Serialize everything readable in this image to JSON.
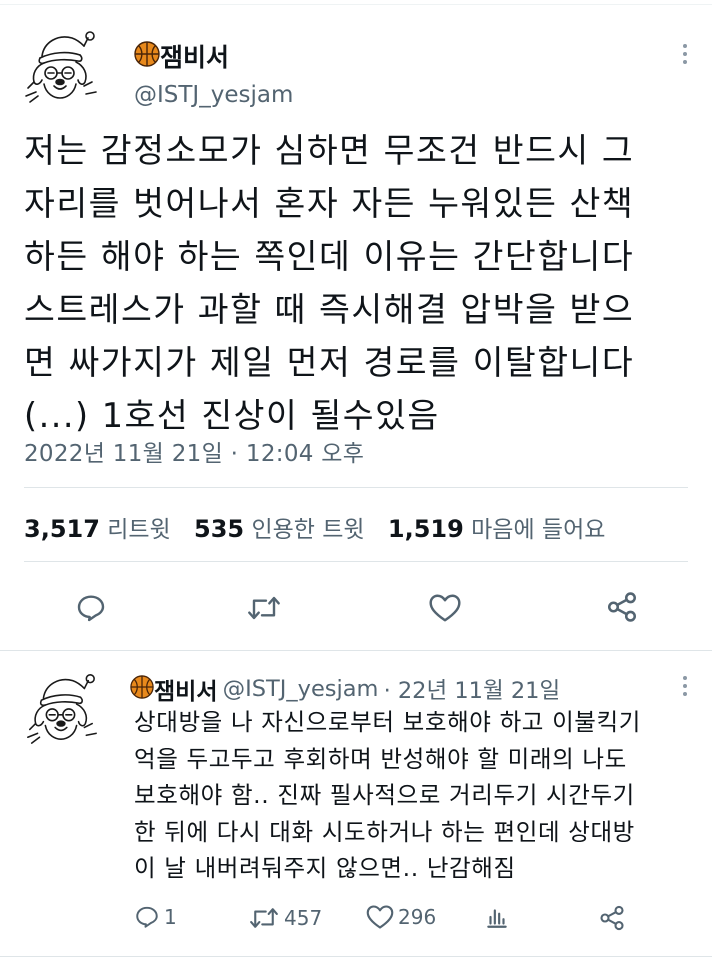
{
  "tweet": {
    "author": {
      "display_name": "잼비서",
      "handle": "@ISTJ_yesjam"
    },
    "text_lines": [
      "저는 감정소모가 심하면 무조건 반드시 그",
      "자리를 벗어나서 혼자 자든 누워있든 산책",
      "하든 해야 하는 쪽인데 이유는 간단합니다",
      "스트레스가 과할 때 즉시해결 압박을 받으",
      "면 싸가지가 제일 먼저 경로를 이탈합니다",
      "(...) 1호선 진상이 될수있음"
    ],
    "timestamp": "2022년 11월 21일 · 12:04 오후",
    "stats": {
      "retweets_count": "3,517",
      "retweets_label": "리트윗",
      "quotes_count": "535",
      "quotes_label": "인용한 트윗",
      "likes_count": "1,519",
      "likes_label": "마음에 들어요"
    }
  },
  "reply": {
    "author": {
      "display_name": "잼비서",
      "handle": "@ISTJ_yesjam"
    },
    "date": "· 22년 11월 21일",
    "text_lines": [
      "상대방을 나 자신으로부터 보호해야 하고 이불킥기",
      "억을 두고두고 후회하며 반성해야 할 미래의 나도",
      "보호해야 함.. 진짜 필사적으로 거리두기 시간두기",
      "한 뒤에 다시 대화 시도하거나 하는 편인데 상대방",
      "이 날 내버려둬주지 않으면.. 난감해짐"
    ],
    "counts": {
      "replies": "1",
      "retweets": "457",
      "likes": "296"
    }
  },
  "icons": {
    "basketball": "basketball-emoji-icon",
    "more": "more-vertical-icon",
    "reply": "reply-icon",
    "retweet": "retweet-icon",
    "like": "heart-icon",
    "share": "share-icon",
    "analytics": "analytics-icon"
  },
  "colors": {
    "text": "#0f1419",
    "secondary": "#536471",
    "divider": "#dfe5e8",
    "basketball": "#e8891c"
  }
}
